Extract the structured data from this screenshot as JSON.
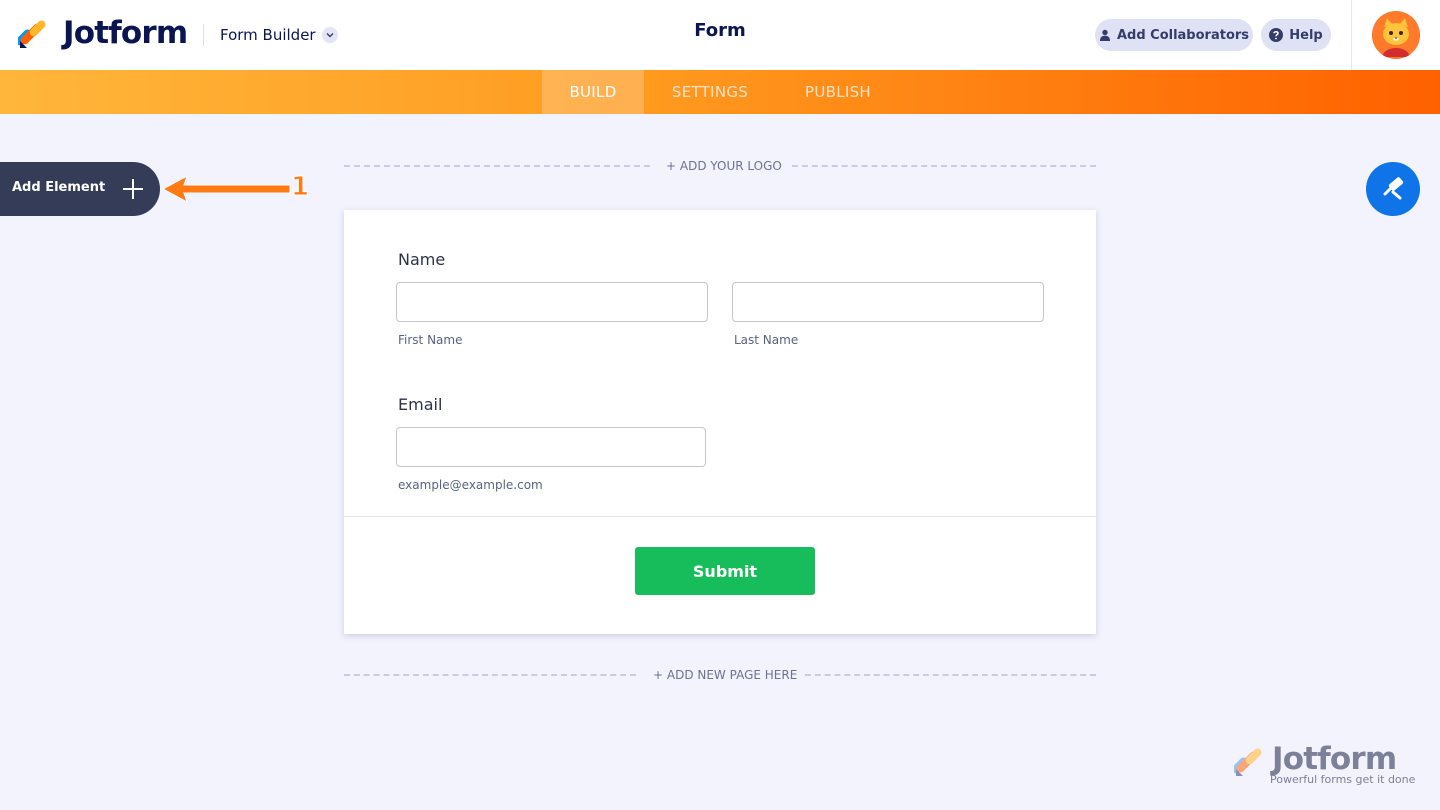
{
  "header": {
    "brand": "Jotform",
    "builder_menu": "Form Builder",
    "form_title": "Form",
    "add_collaborators": "Add Collaborators",
    "help": "Help"
  },
  "nav": {
    "tabs": [
      {
        "label": "BUILD",
        "active": true
      },
      {
        "label": "SETTINGS",
        "active": false
      },
      {
        "label": "PUBLISH",
        "active": false
      }
    ]
  },
  "sidebar": {
    "add_element": "Add Element",
    "annotation_number": "1"
  },
  "canvas": {
    "add_logo": "+ ADD YOUR LOGO",
    "add_page": "+ ADD NEW PAGE HERE"
  },
  "form": {
    "name": {
      "label": "Name",
      "first_value": "",
      "last_value": "",
      "first_sublabel": "First Name",
      "last_sublabel": "Last Name"
    },
    "email": {
      "label": "Email",
      "value": "",
      "sublabel": "example@example.com"
    },
    "submit_label": "Submit"
  },
  "watermark": {
    "brand": "Jotform",
    "tagline": "Powerful forms get it done"
  },
  "colors": {
    "nav_gradient_start": "#ffb63b",
    "nav_gradient_end": "#ff6100",
    "submit": "#18bd5b",
    "fab": "#0f74e8",
    "sidebar_button": "#343c58"
  },
  "icons": {
    "logo": "jotform-logo-icon",
    "chevron": "chevron-down-icon",
    "user": "user-icon",
    "help": "question-circle-icon",
    "avatar": "cat-avatar-icon",
    "plus": "plus-icon",
    "arrow": "annotation-arrow-icon",
    "theme": "paint-roller-icon"
  }
}
